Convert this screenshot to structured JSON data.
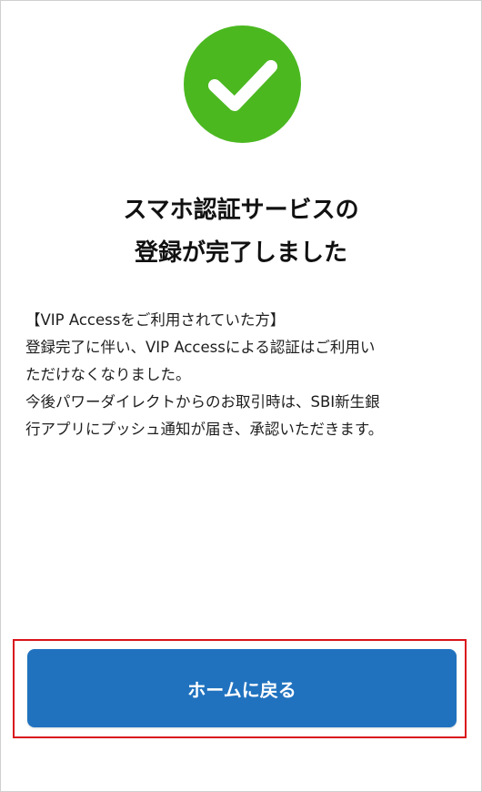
{
  "status": {
    "icon": "check-icon",
    "color": "#4bb820"
  },
  "title": {
    "line1": "スマホ認証サービスの",
    "line2": "登録が完了しました"
  },
  "message": {
    "lines": [
      "【VIP Accessをご利用されていた方】",
      "登録完了に伴い、VIP Accessによる認証はご利用い",
      "ただけなくなりました。",
      "今後パワーダイレクトからのお取引時は、SBI新生銀",
      "行アプリにプッシュ通知が届き、承認いただきます。"
    ]
  },
  "actions": {
    "home_label": "ホームに戻る",
    "home_color": "#2072bf",
    "highlight_color": "#d9141c"
  }
}
